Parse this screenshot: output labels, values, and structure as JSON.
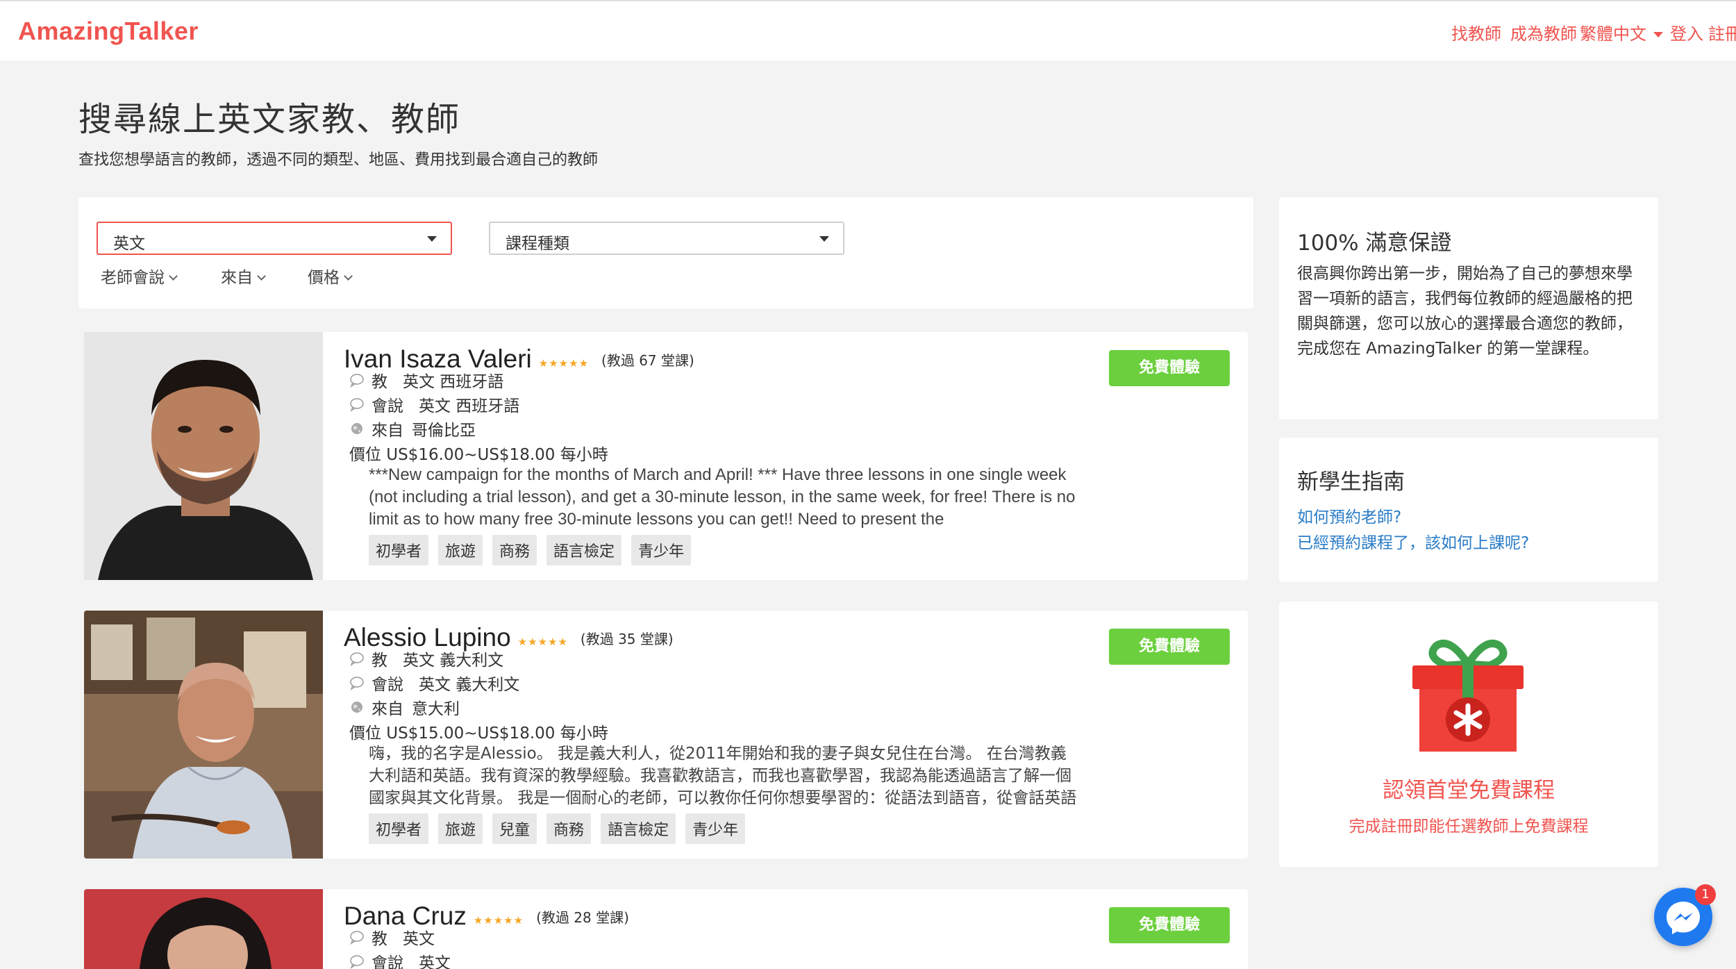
{
  "header": {
    "logo": "AmazingTalker",
    "nav": [
      "找教師",
      "成為教師",
      "繁體中文",
      "登入",
      "註冊"
    ]
  },
  "page": {
    "title": "搜尋線上英文家教、教師",
    "subtitle": "查找您想學語言的教師，透過不同的類型、地區、費用找到最合適自己的教師"
  },
  "filters": {
    "language_select": "英文",
    "course_type_select": "課程種類",
    "links": [
      "老師會說",
      "來自",
      "價格"
    ]
  },
  "labels": {
    "teaches": "教",
    "speaks": "會說",
    "from": "來自",
    "trial_button": "免費體驗",
    "stars": "★★★★★"
  },
  "teachers": [
    {
      "name": "Ivan Isaza Valeri",
      "lessons": "(教過 67 堂課)",
      "teaches": "英文 西班牙語",
      "speaks": "英文 西班牙語",
      "from": "哥倫比亞",
      "price": "價位 US$16.00~US$18.00 每小時",
      "description": "***New campaign for the months of March and April! *** Have three lessons in one single week (not including a trial lesson), and get a 30-minute lesson, in the same week, for free! There is no limit as to how many free 30-minute lessons you can get!! Need to present the",
      "tags": [
        "初學者",
        "旅遊",
        "商務",
        "語言檢定",
        "青少年"
      ]
    },
    {
      "name": "Alessio Lupino",
      "lessons": "(教過 35 堂課)",
      "teaches": "英文 義大利文",
      "speaks": "英文 義大利文",
      "from": "意大利",
      "price": "價位 US$15.00~US$18.00 每小時",
      "description": "嗨，我的名字是Alessio。 我是義大利人，從2011年開始和我的妻子與女兒住在台灣。 在台灣教義大利語和英語。我有資深的教學經驗。我喜歡教語言，而我也喜歡學習，我認為能透過語言了解一個國家與其文化背景。 我是一個耐心的老師，可以教你任何你想要學習的：從語法到語音，從會話英語到商",
      "tags": [
        "初學者",
        "旅遊",
        "兒童",
        "商務",
        "語言檢定",
        "青少年"
      ]
    },
    {
      "name": "Dana Cruz",
      "lessons": "(教過 28 堂課)",
      "teaches": "英文",
      "speaks": "英文"
    }
  ],
  "sidebar": {
    "guarantee": {
      "title": "100% 滿意保證",
      "text": "很高興你跨出第一步，開始為了自己的夢想來學習一項新的語言，我們每位教師的經過嚴格的把關與篩選，您可以放心的選擇最合適您的教師，完成您在 AmazingTalker 的第一堂課程。"
    },
    "guide": {
      "title": "新學生指南",
      "links": [
        "如何預約老師?",
        "已經預約課程了，該如何上課呢?"
      ]
    },
    "gift": {
      "title": "認領首堂免費課程",
      "subtitle": "完成註冊即能任選教師上免費課程"
    }
  },
  "messenger": {
    "badge": "1"
  },
  "colors": {
    "brand": "#f0544f",
    "trial_button": "#6ccf3e",
    "link": "#2a7cc7",
    "stars": "#f5a623"
  },
  "icons": [
    "chat-bubble-icon",
    "globe-icon",
    "chevron-down-icon",
    "gift-icon",
    "messenger-icon"
  ]
}
